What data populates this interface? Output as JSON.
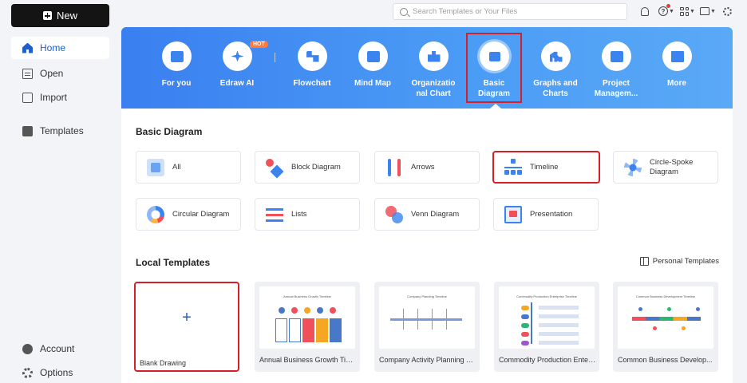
{
  "sidebar": {
    "new_label": "New",
    "items": [
      {
        "label": "Home",
        "icon": "home-icon"
      },
      {
        "label": "Open",
        "icon": "file-icon"
      },
      {
        "label": "Import",
        "icon": "import-icon"
      },
      {
        "label": "Templates",
        "icon": "templates-icon"
      }
    ],
    "bottom": [
      {
        "label": "Account",
        "icon": "account-icon"
      },
      {
        "label": "Options",
        "icon": "gear-icon"
      }
    ]
  },
  "topbar": {
    "search_placeholder": "Search Templates or Your Files"
  },
  "categories": [
    {
      "label": "For you",
      "icon": "for-you-icon"
    },
    {
      "label": "Edraw AI",
      "icon": "sparkle-icon",
      "badge": "HOT"
    },
    {
      "label": "Flowchart",
      "icon": "flowchart-icon"
    },
    {
      "label": "Mind Map",
      "icon": "mind-map-icon"
    },
    {
      "label": "Organizatio nal Chart",
      "icon": "org-chart-icon"
    },
    {
      "label": "Basic Diagram",
      "icon": "basic-diagram-icon",
      "selected": true
    },
    {
      "label": "Graphs and Charts",
      "icon": "bar-chart-icon"
    },
    {
      "label": "Project Managem...",
      "icon": "project-icon"
    },
    {
      "label": "More",
      "icon": "more-grid-icon"
    }
  ],
  "basic_section": {
    "title": "Basic Diagram",
    "types": [
      {
        "label": "All"
      },
      {
        "label": "Block Diagram"
      },
      {
        "label": "Arrows"
      },
      {
        "label": "Timeline",
        "highlighted": true
      },
      {
        "label": "Circle-Spoke Diagram"
      },
      {
        "label": "Circular Diagram"
      },
      {
        "label": "Lists"
      },
      {
        "label": "Venn Diagram"
      },
      {
        "label": "Presentation"
      }
    ]
  },
  "local_section": {
    "title": "Local Templates",
    "personal_label": "Personal Templates",
    "templates": [
      {
        "caption": "Blank Drawing",
        "preview_title": ""
      },
      {
        "caption": "Annual Business Growth Time...",
        "preview_title": "Annual Business Growth Timeline"
      },
      {
        "caption": "Company Activity Planning Ti...",
        "preview_title": "Company Planning Timeline"
      },
      {
        "caption": "Commodity Production Enter...",
        "preview_title": "Commodity Production Enterprise Timeline"
      },
      {
        "caption": "Common Business Develop...",
        "preview_title": "Common Business Development Timeline"
      }
    ]
  },
  "colors": {
    "accent": "#1f5fcc",
    "banner": "#4a9bf5",
    "highlight": "#d3202a"
  }
}
